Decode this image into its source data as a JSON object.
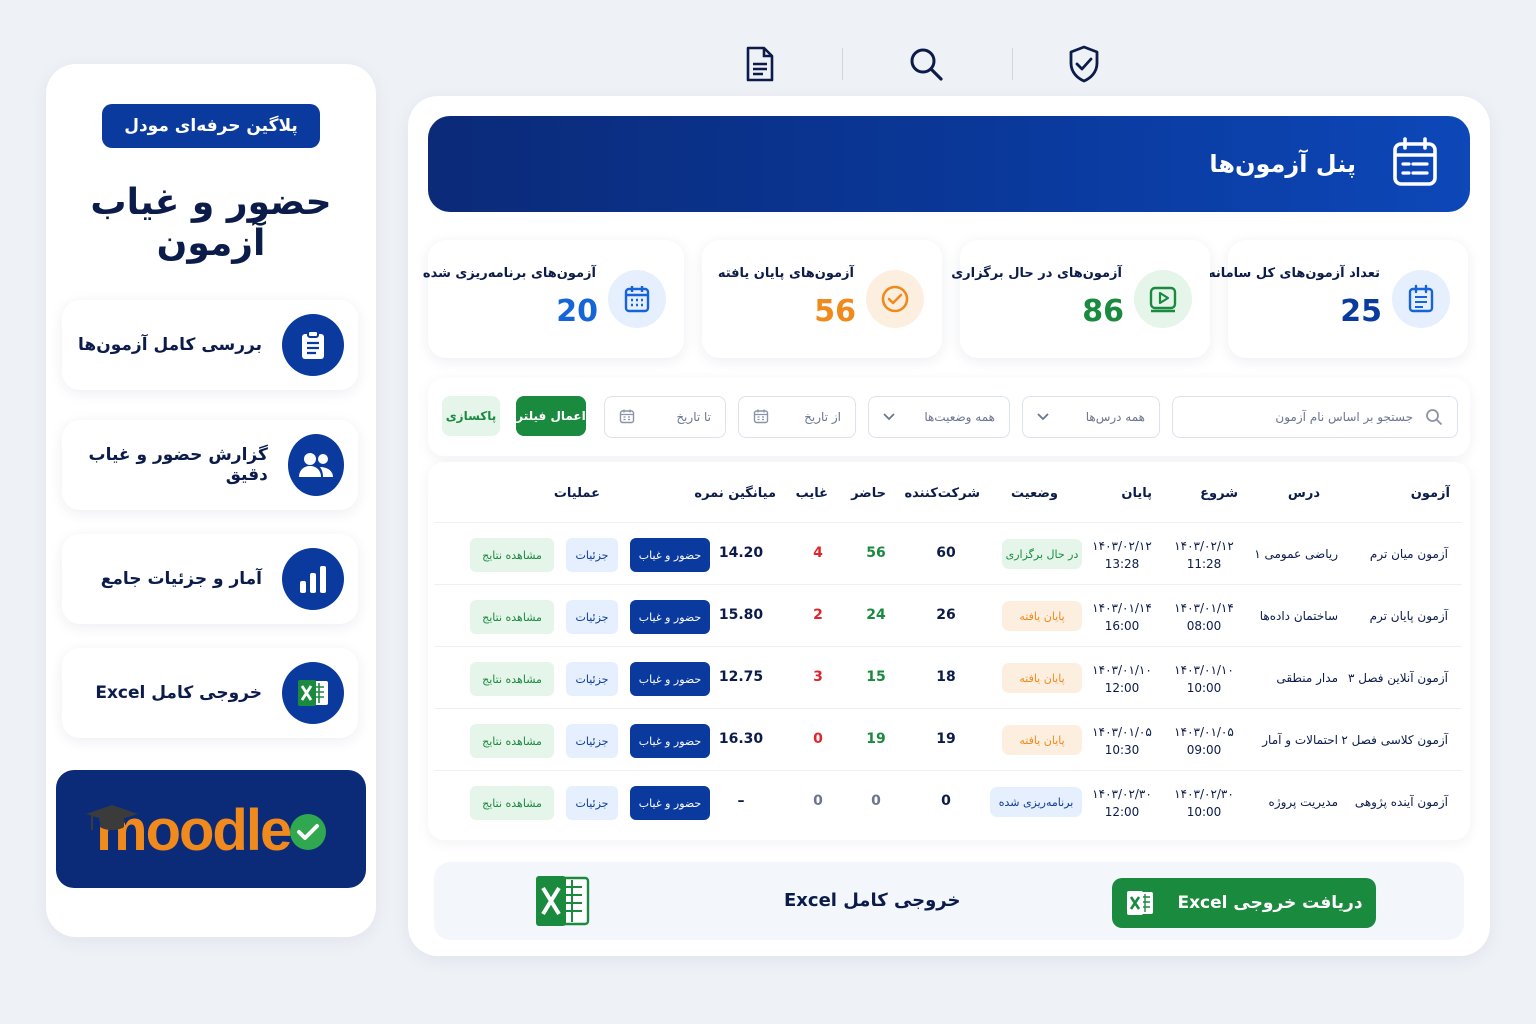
{
  "left": {
    "pill": "پلاگین حرفه‌ای مودل",
    "title": "حضور و غیاب آزمون",
    "features": [
      {
        "label": "بررسی کامل آزمون‌ها",
        "icon": "clipboard-icon"
      },
      {
        "label": "گزارش حضور و غیاب دقیق",
        "icon": "users-icon"
      },
      {
        "label": "آمار و جزئیات جامع",
        "icon": "bar-chart-icon"
      },
      {
        "label": "خروجی کامل Excel",
        "icon": "excel-icon"
      }
    ],
    "moodle_logo": "moodle"
  },
  "top_icons": [
    "document-icon",
    "search-icon",
    "shield-check-icon"
  ],
  "banner": {
    "title": "پنل آزمون‌ها",
    "icon": "calendar-icon"
  },
  "stats": [
    {
      "label": "تعداد آزمون‌های کل سامانه",
      "value": "25",
      "color": "#0a3a9e",
      "icon": "calendar-list-icon"
    },
    {
      "label": "آزمون‌های در حال برگزاری",
      "value": "86",
      "color": "#1a8a3f",
      "icon": "play-video-icon"
    },
    {
      "label": "آزمون‌های پایان یافته",
      "value": "56",
      "color": "#f08a1c",
      "icon": "check-circle-icon"
    },
    {
      "label": "آزمون‌های برنامه‌ریزی شده",
      "value": "20",
      "color": "#1565d8",
      "icon": "calendar-grid-icon"
    }
  ],
  "filters": {
    "search_placeholder": "جستجو بر اساس نام آزمون",
    "course": "همه درس‌ها",
    "status": "همه وضعیت‌ها",
    "from_date": "از تاریخ",
    "to_date": "تا تاریخ",
    "apply": "اعمال فیلتر",
    "clear": "پاکسازی"
  },
  "table": {
    "headers": [
      "آزمون",
      "درس",
      "شروع",
      "پایان",
      "وضعیت",
      "شرکت‌کننده",
      "حاضر",
      "غایب",
      "میانگین نمره",
      "عملیات"
    ],
    "rows": [
      {
        "exam": "آزمون میان ترم",
        "course": "ریاضی عمومی ۱",
        "start_date": "۱۴۰۳/۰۲/۱۲",
        "start_time": "11:28",
        "end_date": "۱۴۰۳/۰۲/۱۲",
        "end_time": "13:28",
        "status": "در حال برگزاری",
        "status_type": "running",
        "participants": "60",
        "present": "56",
        "absent": "4",
        "avg": "14.20"
      },
      {
        "exam": "آزمون پایان ترم",
        "course": "ساختمان داده‌ها",
        "start_date": "۱۴۰۳/۰۱/۱۴",
        "start_time": "08:00",
        "end_date": "۱۴۰۳/۰۱/۱۴",
        "end_time": "16:00",
        "status": "پایان یافته",
        "status_type": "ended",
        "participants": "26",
        "present": "24",
        "absent": "2",
        "avg": "15.80"
      },
      {
        "exam": "آزمون آنلاین فصل ۳",
        "course": "مدار منطقی",
        "start_date": "۱۴۰۳/۰۱/۱۰",
        "start_time": "10:00",
        "end_date": "۱۴۰۳/۰۱/۱۰",
        "end_time": "12:00",
        "status": "پایان یافته",
        "status_type": "ended",
        "participants": "18",
        "present": "15",
        "absent": "3",
        "avg": "12.75"
      },
      {
        "exam": "آزمون کلاسی فصل ۲",
        "course": "احتمالات و آمار",
        "start_date": "۱۴۰۳/۰۱/۰۵",
        "start_time": "09:00",
        "end_date": "۱۴۰۳/۰۱/۰۵",
        "end_time": "10:30",
        "status": "پایان یافته",
        "status_type": "ended",
        "participants": "19",
        "present": "19",
        "absent": "0",
        "avg": "16.30"
      },
      {
        "exam": "آزمون آینده پژوهی",
        "course": "مدیریت پروژه",
        "start_date": "۱۴۰۳/۰۲/۳۰",
        "start_time": "10:00",
        "end_date": "۱۴۰۳/۰۲/۳۰",
        "end_time": "12:00",
        "status": "برنامه‌ریزی شده",
        "status_type": "scheduled",
        "participants": "0",
        "present": "0",
        "absent": "0",
        "avg": "–"
      }
    ],
    "actions": {
      "attendance": "حضور و غیاب",
      "details": "جزئیات",
      "results": "مشاهده نتایج"
    }
  },
  "export": {
    "label": "خروجی کامل Excel",
    "button": "دریافت خروجی Excel"
  },
  "colors": {
    "primary": "#0a3a9e",
    "green": "#1a8a3f",
    "orange": "#f08a1c",
    "red": "#e0242b"
  }
}
